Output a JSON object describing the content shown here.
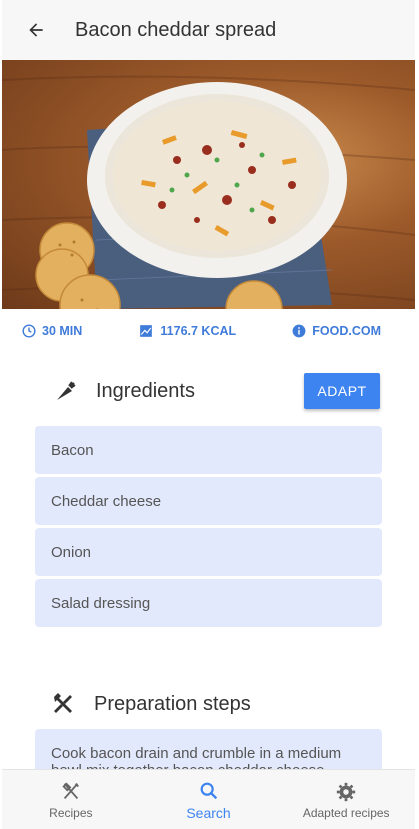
{
  "appbar": {
    "title": "Bacon cheddar spread"
  },
  "hero": {
    "image": "bacon-cheddar-dip-photo"
  },
  "meta": {
    "time": "30 MIN",
    "calories": "1176.7 KCAL",
    "source": "FOOD.COM"
  },
  "ingredients": {
    "title": "Ingredients",
    "adapt_label": "ADAPT",
    "items": [
      "Bacon",
      "Cheddar cheese",
      "Onion",
      "Salad dressing"
    ]
  },
  "steps": {
    "title": "Preparation steps",
    "first_step": "Cook bacon drain and crumble in a medium bowl mix together bacon cheddar cheese"
  },
  "nav": {
    "items": [
      {
        "label": "Recipes",
        "icon": "utensils-icon",
        "active": false
      },
      {
        "label": "Search",
        "icon": "search-icon",
        "active": true
      },
      {
        "label": "Adapted recipes",
        "icon": "gear-icon",
        "active": false
      }
    ]
  },
  "colors": {
    "accent": "#3d84f0",
    "card_bg": "#e3e9fc",
    "bar_bg": "#f7f7f7"
  }
}
